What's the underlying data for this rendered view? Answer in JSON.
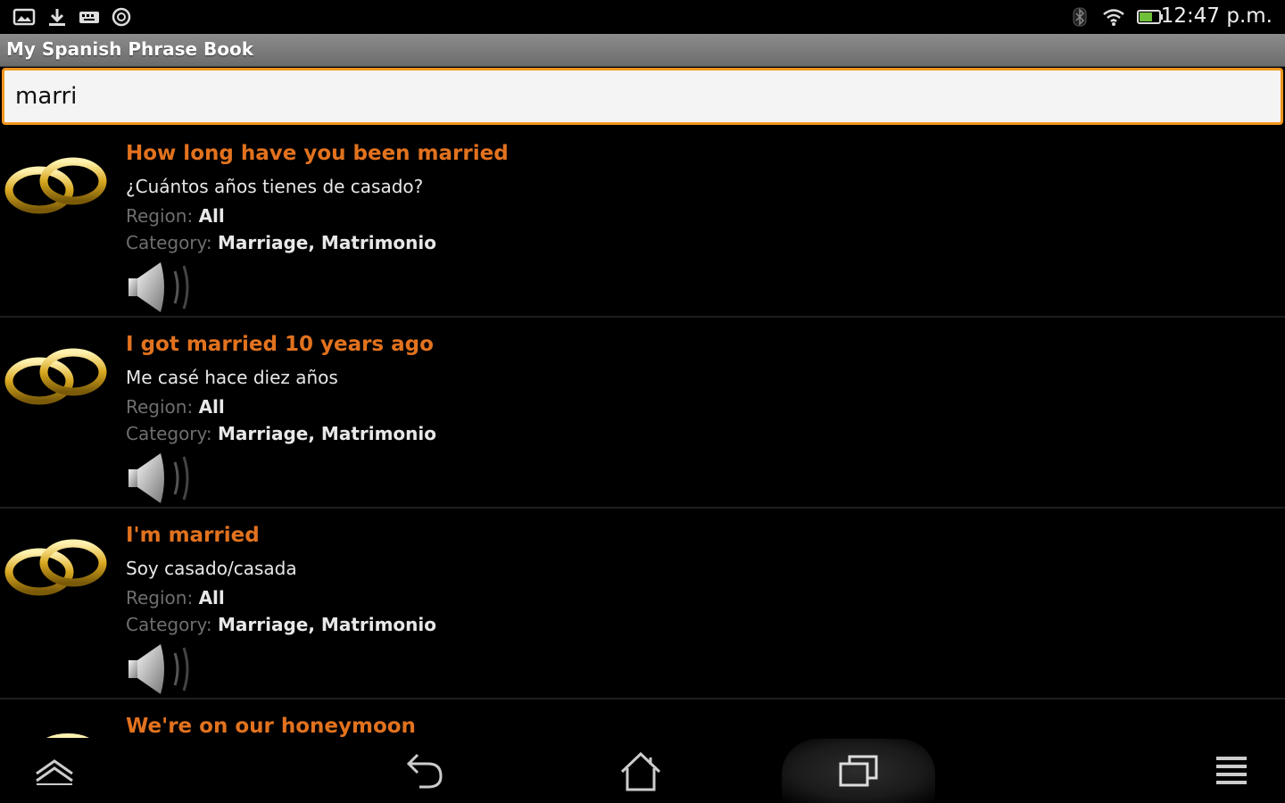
{
  "status_bar": {
    "time": "12:47 p.m.",
    "left_icons": [
      "gallery-icon",
      "download-icon",
      "keyboard-icon",
      "sync-icon"
    ],
    "right_icons": [
      "bluetooth-icon",
      "wifi-icon",
      "battery-icon"
    ]
  },
  "app": {
    "title": "My Spanish Phrase Book"
  },
  "search": {
    "value": "marri",
    "accent_color": "#f0961e"
  },
  "labels": {
    "region": "Region:",
    "category": "Category:"
  },
  "phrases": [
    {
      "english": "How long have you been married",
      "spanish": "¿Cuántos años tienes de casado?",
      "region": "All",
      "category": "Marriage, Matrimonio"
    },
    {
      "english": "I got married 10 years ago",
      "spanish": "Me casé hace diez años",
      "region": "All",
      "category": "Marriage, Matrimonio"
    },
    {
      "english": "I'm married",
      "spanish": "Soy casado/casada",
      "region": "All",
      "category": "Marriage, Matrimonio"
    },
    {
      "english": "We're on our honeymoon"
    }
  ],
  "nav_bar": {
    "buttons": [
      "collapse-icon",
      "back-icon",
      "home-icon",
      "recent-apps-icon",
      "menu-icon"
    ]
  },
  "colors": {
    "english_text": "#e2721e",
    "background": "#000000",
    "title_bar": "#7a7a7a"
  }
}
